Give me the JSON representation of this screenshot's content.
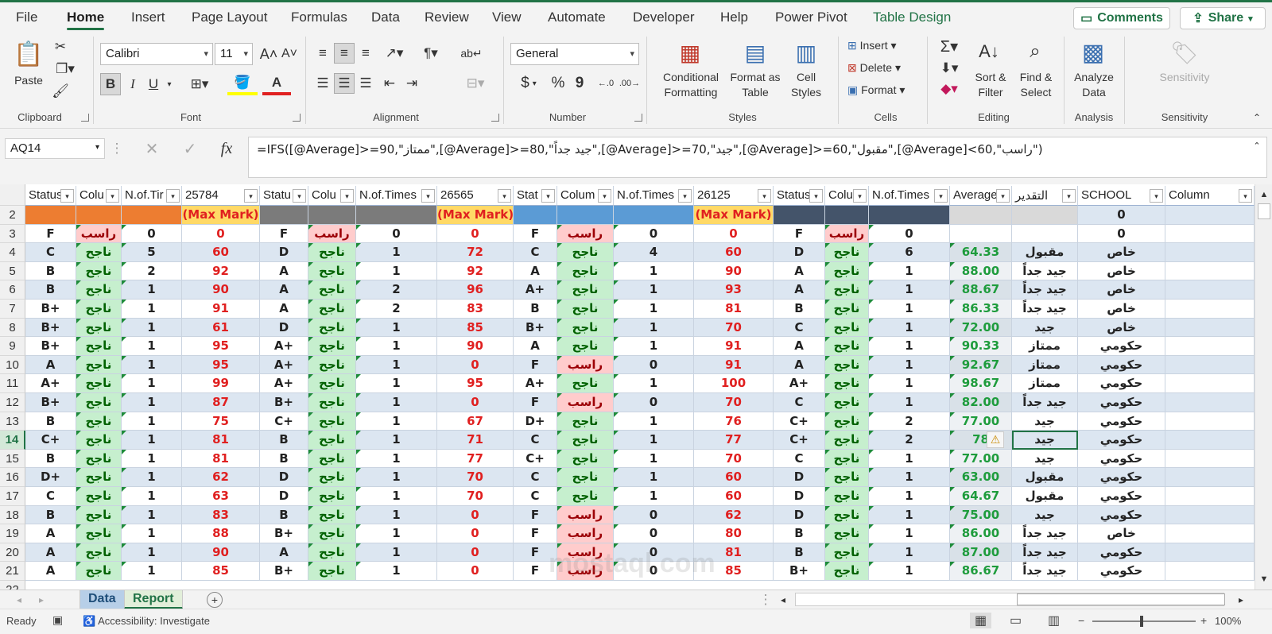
{
  "colors": {
    "accent": "#217346",
    "red_text": "#e02020",
    "green_text": "#1e9c3c",
    "fail_bg": "#ffcccc",
    "pass_bg": "#c6efce",
    "band1": "#ed7d31",
    "band2": "#7b7b7b",
    "band3": "#5b9bd5",
    "band4": "#44546a",
    "maxmark_bg": "#ffd966",
    "stripe": "#dce6f1"
  },
  "menu": {
    "tabs": [
      "File",
      "Home",
      "Insert",
      "Page Layout",
      "Formulas",
      "Data",
      "Review",
      "View",
      "Automate",
      "Developer",
      "Help",
      "Power Pivot",
      "Table Design"
    ],
    "comments": "Comments",
    "share": "Share"
  },
  "ribbon": {
    "clipboard": {
      "label": "Clipboard",
      "paste": "Paste"
    },
    "font": {
      "label": "Font",
      "name": "Calibri",
      "size": "11",
      "bold": "B",
      "italic": "I",
      "underline": "U"
    },
    "alignment": {
      "label": "Alignment"
    },
    "number": {
      "label": "Number",
      "format": "General",
      "currency": "$",
      "percent": "%",
      "comma": "9"
    },
    "styles": {
      "label": "Styles",
      "conditional": "Conditional\nFormatting",
      "format_table": "Format as\nTable",
      "cell_styles": "Cell\nStyles"
    },
    "cells": {
      "label": "Cells",
      "insert": "Insert",
      "delete": "Delete",
      "format": "Format"
    },
    "editing": {
      "label": "Editing",
      "sort": "Sort &\nFilter",
      "find": "Find &\nSelect"
    },
    "analysis": {
      "label": "Analysis",
      "analyze": "Analyze\nData"
    },
    "sensitivity": {
      "label": "Sensitivity",
      "btn": "Sensitivity"
    }
  },
  "formula_bar": {
    "name_box": "AQ14",
    "fx": "fx",
    "formula": "=IFS([@Average]>=90,\"ممتاز\",[@Average]>=80,\"جيد جداً\",[@Average]>=70,\"جيد\",[@Average]>=60,\"مقبول\",[@Average]<60,\"راسب\")"
  },
  "headers": [
    "Status",
    "Colu",
    "N.of.Tir",
    "25784",
    "Statu",
    "Colu",
    "N.of.Times",
    "26565",
    "Stat",
    "Colum",
    "N.of.Times",
    "26125",
    "Status",
    "Colu",
    "N.of.Times",
    "Average",
    "التقدير",
    "SCHOOL",
    "Column"
  ],
  "row2": {
    "maxmark": "(Max Mark)",
    "school": "0"
  },
  "rows": [
    {
      "n": 3,
      "v": [
        "F",
        "راسب",
        "0",
        "0",
        "F",
        "راسب",
        "0",
        "0",
        "F",
        "راسب",
        "0",
        "0",
        "F",
        "راسب",
        "0",
        "",
        "",
        "0",
        ""
      ]
    },
    {
      "n": 4,
      "v": [
        "C",
        "ناجح",
        "5",
        "60",
        "D",
        "ناجح",
        "1",
        "72",
        "C",
        "ناجح",
        "4",
        "60",
        "D",
        "ناجح",
        "6",
        "64.33",
        "مقبول",
        "خاص",
        ""
      ]
    },
    {
      "n": 5,
      "v": [
        "B",
        "ناجح",
        "2",
        "92",
        "A",
        "ناجح",
        "1",
        "92",
        "A",
        "ناجح",
        "1",
        "90",
        "A",
        "ناجح",
        "1",
        "88.00",
        "جيد جداً",
        "خاص",
        ""
      ]
    },
    {
      "n": 6,
      "v": [
        "B",
        "ناجح",
        "1",
        "90",
        "A",
        "ناجح",
        "2",
        "96",
        "A+",
        "ناجح",
        "1",
        "93",
        "A",
        "ناجح",
        "1",
        "88.67",
        "جيد جداً",
        "خاص",
        ""
      ]
    },
    {
      "n": 7,
      "v": [
        "B+",
        "ناجح",
        "1",
        "91",
        "A",
        "ناجح",
        "2",
        "83",
        "B",
        "ناجح",
        "1",
        "81",
        "B",
        "ناجح",
        "1",
        "86.33",
        "جيد جداً",
        "خاص",
        ""
      ]
    },
    {
      "n": 8,
      "v": [
        "B+",
        "ناجح",
        "1",
        "61",
        "D",
        "ناجح",
        "1",
        "85",
        "B+",
        "ناجح",
        "1",
        "70",
        "C",
        "ناجح",
        "1",
        "72.00",
        "جيد",
        "خاص",
        ""
      ]
    },
    {
      "n": 9,
      "v": [
        "B+",
        "ناجح",
        "1",
        "95",
        "A+",
        "ناجح",
        "1",
        "90",
        "A",
        "ناجح",
        "1",
        "91",
        "A",
        "ناجح",
        "1",
        "90.33",
        "ممتاز",
        "حكومي",
        ""
      ]
    },
    {
      "n": 10,
      "v": [
        "A",
        "ناجح",
        "1",
        "95",
        "A+",
        "ناجح",
        "1",
        "0",
        "F",
        "راسب",
        "0",
        "91",
        "A",
        "ناجح",
        "1",
        "92.67",
        "ممتاز",
        "حكومي",
        ""
      ]
    },
    {
      "n": 11,
      "v": [
        "A+",
        "ناجح",
        "1",
        "99",
        "A+",
        "ناجح",
        "1",
        "95",
        "A+",
        "ناجح",
        "1",
        "100",
        "A+",
        "ناجح",
        "1",
        "98.67",
        "ممتاز",
        "حكومي",
        ""
      ]
    },
    {
      "n": 12,
      "v": [
        "B+",
        "ناجح",
        "1",
        "87",
        "B+",
        "ناجح",
        "1",
        "0",
        "F",
        "راسب",
        "0",
        "70",
        "C",
        "ناجح",
        "1",
        "82.00",
        "جيد جداً",
        "حكومي",
        ""
      ]
    },
    {
      "n": 13,
      "v": [
        "B",
        "ناجح",
        "1",
        "75",
        "C+",
        "ناجح",
        "1",
        "67",
        "D+",
        "ناجح",
        "1",
        "76",
        "C+",
        "ناجح",
        "2",
        "77.00",
        "جيد",
        "حكومي",
        ""
      ]
    },
    {
      "n": 14,
      "v": [
        "C+",
        "ناجح",
        "1",
        "81",
        "B",
        "ناجح",
        "1",
        "71",
        "C",
        "ناجح",
        "1",
        "77",
        "C+",
        "ناجح",
        "2",
        "78",
        "جيد",
        "حكومي",
        ""
      ]
    },
    {
      "n": 15,
      "v": [
        "B",
        "ناجح",
        "1",
        "81",
        "B",
        "ناجح",
        "1",
        "77",
        "C+",
        "ناجح",
        "1",
        "70",
        "C",
        "ناجح",
        "1",
        "77.00",
        "جيد",
        "حكومي",
        ""
      ]
    },
    {
      "n": 16,
      "v": [
        "D+",
        "ناجح",
        "1",
        "62",
        "D",
        "ناجح",
        "1",
        "70",
        "C",
        "ناجح",
        "1",
        "60",
        "D",
        "ناجح",
        "1",
        "63.00",
        "مقبول",
        "حكومي",
        ""
      ]
    },
    {
      "n": 17,
      "v": [
        "C",
        "ناجح",
        "1",
        "63",
        "D",
        "ناجح",
        "1",
        "70",
        "C",
        "ناجح",
        "1",
        "60",
        "D",
        "ناجح",
        "1",
        "64.67",
        "مقبول",
        "حكومي",
        ""
      ]
    },
    {
      "n": 18,
      "v": [
        "B",
        "ناجح",
        "1",
        "83",
        "B",
        "ناجح",
        "1",
        "0",
        "F",
        "راسب",
        "0",
        "62",
        "D",
        "ناجح",
        "1",
        "75.00",
        "جيد",
        "حكومي",
        ""
      ]
    },
    {
      "n": 19,
      "v": [
        "A",
        "ناجح",
        "1",
        "88",
        "B+",
        "ناجح",
        "1",
        "0",
        "F",
        "راسب",
        "0",
        "80",
        "B",
        "ناجح",
        "1",
        "86.00",
        "جيد جداً",
        "خاص",
        ""
      ]
    },
    {
      "n": 20,
      "v": [
        "A",
        "ناجح",
        "1",
        "90",
        "A",
        "ناجح",
        "1",
        "0",
        "F",
        "راسب",
        "0",
        "81",
        "B",
        "ناجح",
        "1",
        "87.00",
        "جيد جداً",
        "حكومي",
        ""
      ]
    },
    {
      "n": 21,
      "v": [
        "A",
        "ناجح",
        "1",
        "85",
        "B+",
        "ناجح",
        "1",
        "0",
        "F",
        "راسب",
        "0",
        "85",
        "B+",
        "ناجح",
        "1",
        "86.67",
        "جيد جداً",
        "حكومي",
        ""
      ]
    }
  ],
  "selected_row": 14,
  "sheets": [
    "Data",
    "Report"
  ],
  "status": {
    "ready": "Ready",
    "accessibility": "Accessibility: Investigate",
    "zoom": "100%"
  },
  "watermark": "mostaql.com"
}
